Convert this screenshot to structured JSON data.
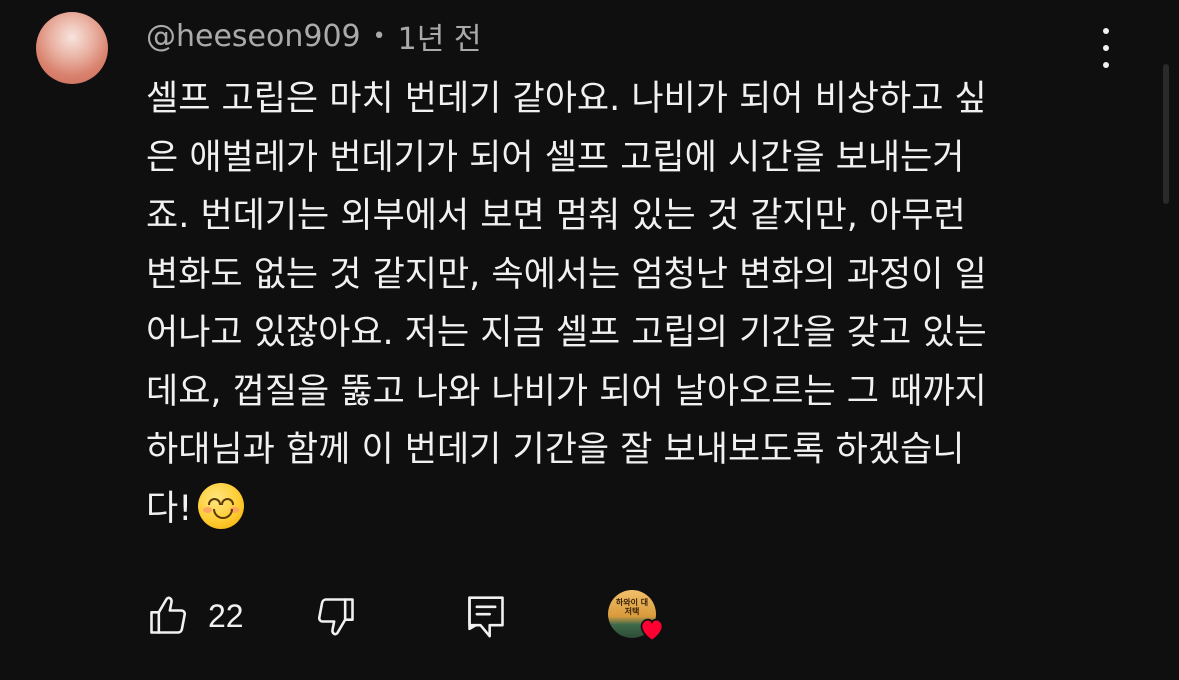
{
  "comment": {
    "username": "@heeseon909",
    "separator": "•",
    "timestamp": "1년 전",
    "lines": [
      "셀프 고립은 마치 번데기 같아요. 나비가 되어 비상하고 싶",
      "은 애벌레가 번데기가 되어 셀프 고립에 시간을 보내는거",
      "죠. 번데기는 외부에서 보면 멈춰 있는 것 같지만, 아무런",
      "변화도 없는 것 같지만, 속에서는 엄청난 변화의 과정이 일",
      "어나고 있잖아요. 저는 지금 셀프 고립의 기간을 갖고 있는",
      "데요, 껍질을 뚫고 나와 나비가 되어 날아오르는 그 때까지",
      "하대님과 함께 이 번데기 기간을 잘 보내보도록 하겠습니",
      "다!"
    ],
    "trailing_emoji": "smiling-face-with-smiling-eyes"
  },
  "actions": {
    "like_count": "22",
    "creator_badge_text": "하와이 대저택",
    "creator_heart_color": "#ff0033"
  },
  "colors": {
    "background": "#0f0f0f",
    "text_primary": "#f1f1f1",
    "text_secondary": "#aaaaaa"
  }
}
